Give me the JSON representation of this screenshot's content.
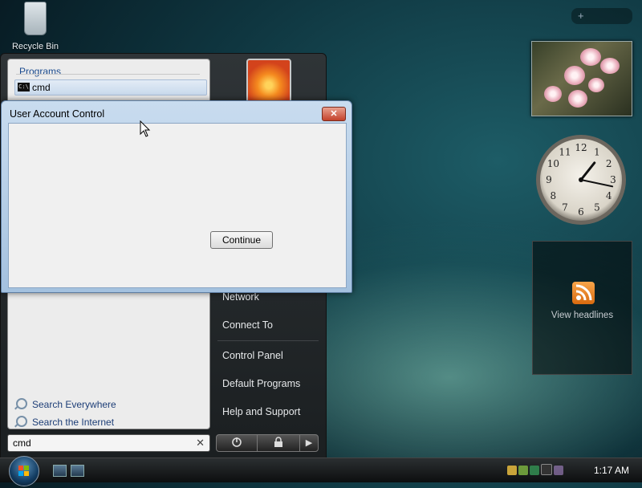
{
  "desktop": {
    "recycle_bin_label": "Recycle Bin"
  },
  "gadgets": {
    "clock": {
      "hour": 1,
      "minute": 17,
      "numbers": [
        "12",
        "1",
        "2",
        "3",
        "4",
        "5",
        "6",
        "7",
        "8",
        "9",
        "10",
        "11"
      ]
    },
    "feeds": {
      "label": "View headlines",
      "icon": "rss-feed-icon"
    }
  },
  "start_menu": {
    "programs_heading": "Programs",
    "program_items": [
      {
        "label": "cmd",
        "icon": "command-prompt-icon"
      }
    ],
    "search_links": [
      "Search Everywhere",
      "Search the Internet"
    ],
    "search_value": "cmd",
    "search_clear": "✕",
    "right_items": [
      "Network",
      "Connect To",
      "Control Panel",
      "Default Programs",
      "Help and Support"
    ],
    "power_icon": "power-icon",
    "lock_icon": "lock-icon",
    "arrow_glyph": "▶"
  },
  "dialog": {
    "title": "User Account Control",
    "close_glyph": "✕",
    "continue_label": "Continue"
  },
  "taskbar": {
    "time": "1:17 AM"
  },
  "colors": {
    "accent": "#1b4b8f",
    "link": "#1d3e77"
  }
}
